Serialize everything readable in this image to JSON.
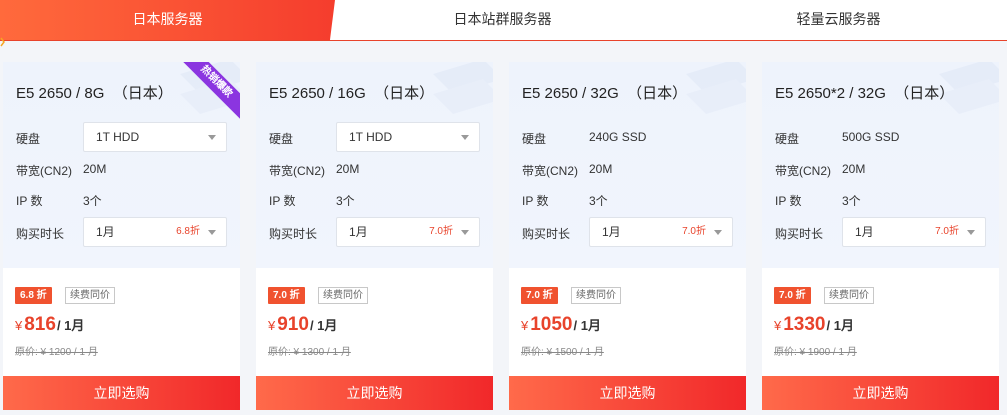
{
  "tabs": [
    {
      "label": "日本服务器",
      "active": true
    },
    {
      "label": "日本站群服务器",
      "active": false
    },
    {
      "label": "轻量云服务器",
      "active": false
    }
  ],
  "labels": {
    "disk": "硬盘",
    "bandwidth": "带宽(CN2)",
    "ip": "IP 数",
    "duration": "购买时长",
    "renew": "续费同价",
    "buy": "立即选购"
  },
  "colors": {
    "accent": "#e8432b",
    "ribbon": "#8b35e0"
  },
  "cards": [
    {
      "title": "E5 2650 / 8G  （日本）",
      "ribbon": "热销爆款",
      "disk": "1T HDD",
      "disk_is_select": true,
      "bandwidth": "20M",
      "ip": "3个",
      "duration": "1月",
      "duration_discount": "6.8折",
      "discount_badge": "6.8 折",
      "price_symbol": "¥",
      "price": "816",
      "price_unit": "/ 1月",
      "original_price": "原价: ¥ 1200 / 1 月"
    },
    {
      "title": "E5 2650 / 16G  （日本）",
      "ribbon": "",
      "disk": "1T HDD",
      "disk_is_select": true,
      "bandwidth": "20M",
      "ip": "3个",
      "duration": "1月",
      "duration_discount": "7.0折",
      "discount_badge": "7.0 折",
      "price_symbol": "¥",
      "price": "910",
      "price_unit": "/ 1月",
      "original_price": "原价: ¥ 1300 / 1 月"
    },
    {
      "title": "E5 2650 / 32G  （日本）",
      "ribbon": "",
      "disk": "240G SSD",
      "disk_is_select": false,
      "bandwidth": "20M",
      "ip": "3个",
      "duration": "1月",
      "duration_discount": "7.0折",
      "discount_badge": "7.0 折",
      "price_symbol": "¥",
      "price": "1050",
      "price_unit": "/ 1月",
      "original_price": "原价: ¥ 1500 / 1 月"
    },
    {
      "title": "E5 2650*2 / 32G  （日本）",
      "ribbon": "",
      "disk": "500G SSD",
      "disk_is_select": false,
      "bandwidth": "20M",
      "ip": "3个",
      "duration": "1月",
      "duration_discount": "7.0折",
      "discount_badge": "7.0 折",
      "price_symbol": "¥",
      "price": "1330",
      "price_unit": "/ 1月",
      "original_price": "原价: ¥ 1900 / 1 月"
    }
  ]
}
